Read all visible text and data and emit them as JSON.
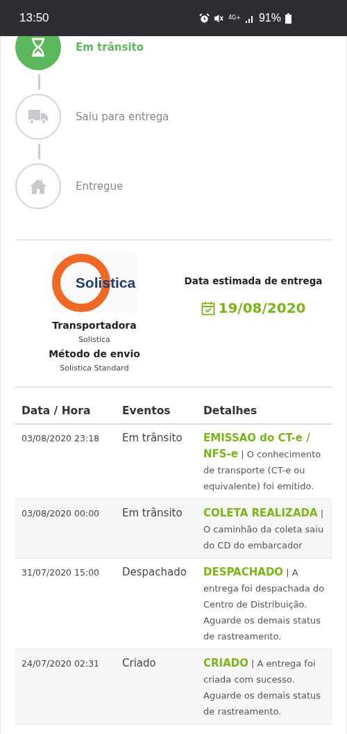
{
  "status_bar": {
    "time": "13:50",
    "network": "4G+",
    "battery": "91%"
  },
  "steps": [
    {
      "kind": "hourglass",
      "label": "Em trânsito",
      "active": true
    },
    {
      "kind": "truck",
      "label": "Saiu para entrega",
      "active": false
    },
    {
      "kind": "home",
      "label": "Entregue",
      "active": false
    }
  ],
  "carrier": {
    "logo_text": "Solistica",
    "carrier_label": "Transportadora",
    "carrier_name": "Solistica",
    "method_label": "Método de envio",
    "method_name": "Solistica Standard"
  },
  "delivery": {
    "label": "Data estimada de entrega",
    "date": "19/08/2020"
  },
  "table": {
    "columns": [
      "Data / Hora",
      "Eventos",
      "Detalhes"
    ],
    "rows": [
      {
        "datetime": "03/08/2020 23:18",
        "event": "Em trânsito",
        "details": "**EMISSAO do CT-e / NFS-e** | O conhecimento de transporte (CT-e ou equivalente) foi emitido."
      },
      {
        "datetime": "03/08/2020 00:00",
        "event": "Em trânsito",
        "details": "**COLETA REALIZADA** | O caminhão da coleta saiu do CD do embarcador"
      },
      {
        "datetime": "31/07/2020 15:00",
        "event": "Despachado",
        "details": "**DESPACHADO** | A entrega foi despachada do Centro de Distribuição. Aguarde os demais status de rastreamento."
      },
      {
        "datetime": "24/07/2020 02:31",
        "event": "Criado",
        "details": "**CRIADO** | A entrega foi criada com sucesso. Aguarde os demais status de rastreamento."
      }
    ]
  }
}
